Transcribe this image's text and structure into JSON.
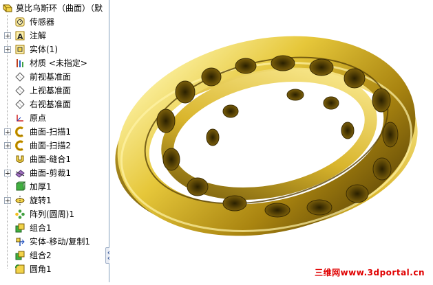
{
  "tree": {
    "root_label": "莫比乌斯环（曲面）（默",
    "items": [
      {
        "label": "传感器",
        "icon": "sensor-icon",
        "expandable": false
      },
      {
        "label": "注解",
        "icon": "annotation-icon",
        "expandable": true
      },
      {
        "label": "实体(1)",
        "icon": "solid-bodies-icon",
        "expandable": true
      },
      {
        "label": "材质 <未指定>",
        "icon": "material-icon",
        "expandable": false
      },
      {
        "label": "前视基准面",
        "icon": "plane-icon",
        "expandable": false
      },
      {
        "label": "上视基准面",
        "icon": "plane-icon",
        "expandable": false
      },
      {
        "label": "右视基准面",
        "icon": "plane-icon",
        "expandable": false
      },
      {
        "label": "原点",
        "icon": "origin-icon",
        "expandable": false
      },
      {
        "label": "曲面-扫描1",
        "icon": "surface-sweep-icon",
        "expandable": true
      },
      {
        "label": "曲面-扫描2",
        "icon": "surface-sweep-icon",
        "expandable": true
      },
      {
        "label": "曲面-缝合1",
        "icon": "surface-knit-icon",
        "expandable": false
      },
      {
        "label": "曲面-剪裁1",
        "icon": "surface-trim-icon",
        "expandable": true
      },
      {
        "label": "加厚1",
        "icon": "thicken-icon",
        "expandable": false
      },
      {
        "label": "旋转1",
        "icon": "revolve-icon",
        "expandable": true
      },
      {
        "label": "阵列(圆周)1",
        "icon": "circular-pattern-icon",
        "expandable": false
      },
      {
        "label": "组合1",
        "icon": "combine-icon",
        "expandable": false
      },
      {
        "label": "实体-移动/复制1",
        "icon": "move-copy-body-icon",
        "expandable": false
      },
      {
        "label": "组合2",
        "icon": "combine-icon",
        "expandable": false
      },
      {
        "label": "圆角1",
        "icon": "fillet-icon",
        "expandable": false
      }
    ]
  },
  "viewport": {
    "model": "mobius-ring-model",
    "colors": {
      "gold_light": "#f4e27a",
      "gold_mid": "#c9a520",
      "gold_dark": "#6b5208"
    },
    "watermark": "三维网www.3dportal.cn"
  }
}
